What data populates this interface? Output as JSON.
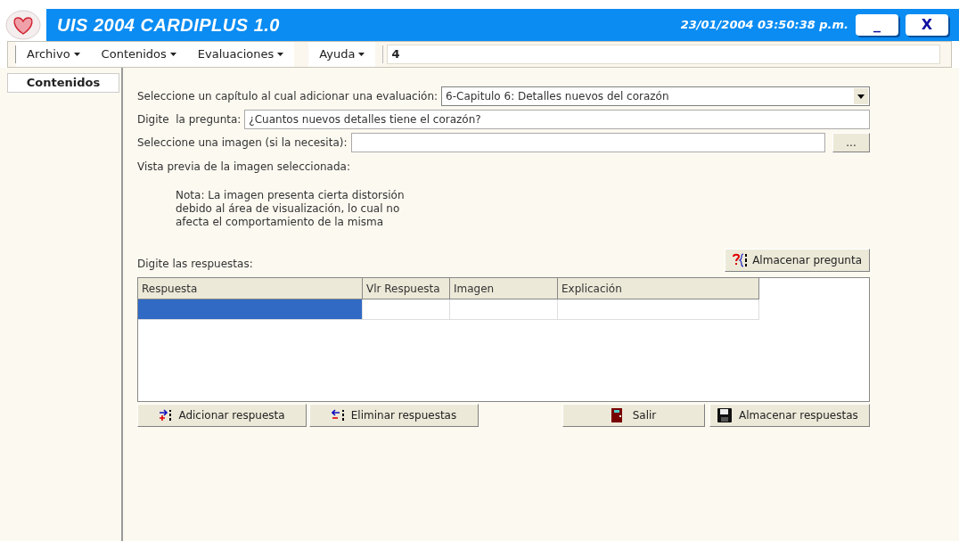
{
  "window": {
    "title": "UIS 2004 CARDIPLUS 1.0",
    "datetime": "23/01/2004 03:50:38 p.m.",
    "minimize": "_",
    "close": "X"
  },
  "menu": [
    {
      "label": "Archivo"
    },
    {
      "label": "Contenidos"
    },
    {
      "label": "Evaluaciones"
    },
    {
      "label": "Ayuda"
    }
  ],
  "menu_field": {
    "value": "4"
  },
  "sidebar": {
    "items": [
      {
        "label": "Contenidos"
      }
    ]
  },
  "form": {
    "chapter_label": "Seleccione un capítulo al cual adicionar una evaluación:",
    "chapter_value": "6-Capitulo 6: Detalles nuevos del corazón",
    "question_label": "Digite  la pregunta:",
    "question_value": "¿Cuantos nuevos detalles tiene el corazón?",
    "image_label": "Seleccione una imagen (si la necesita):",
    "browse_button": "...",
    "preview_label": "Vista previa de la imagen seleccionada:",
    "note": "Nota: La imagen presenta cierta distorsión debido al área de visualización, lo cual no afecta el comportamiento de la misma",
    "save_question_button": "Almacenar pregunta",
    "answers_label": "Digite las respuestas:"
  },
  "table": {
    "columns": [
      "Respuesta",
      "Vlr Respuesta",
      "Imagen",
      "Explicación"
    ],
    "rows": [
      {
        "selected": true
      }
    ]
  },
  "buttons": {
    "add": "Adicionar respuesta",
    "remove": "Eliminar respuestas",
    "exit": "Salir",
    "save": "Almacenar respuestas"
  }
}
